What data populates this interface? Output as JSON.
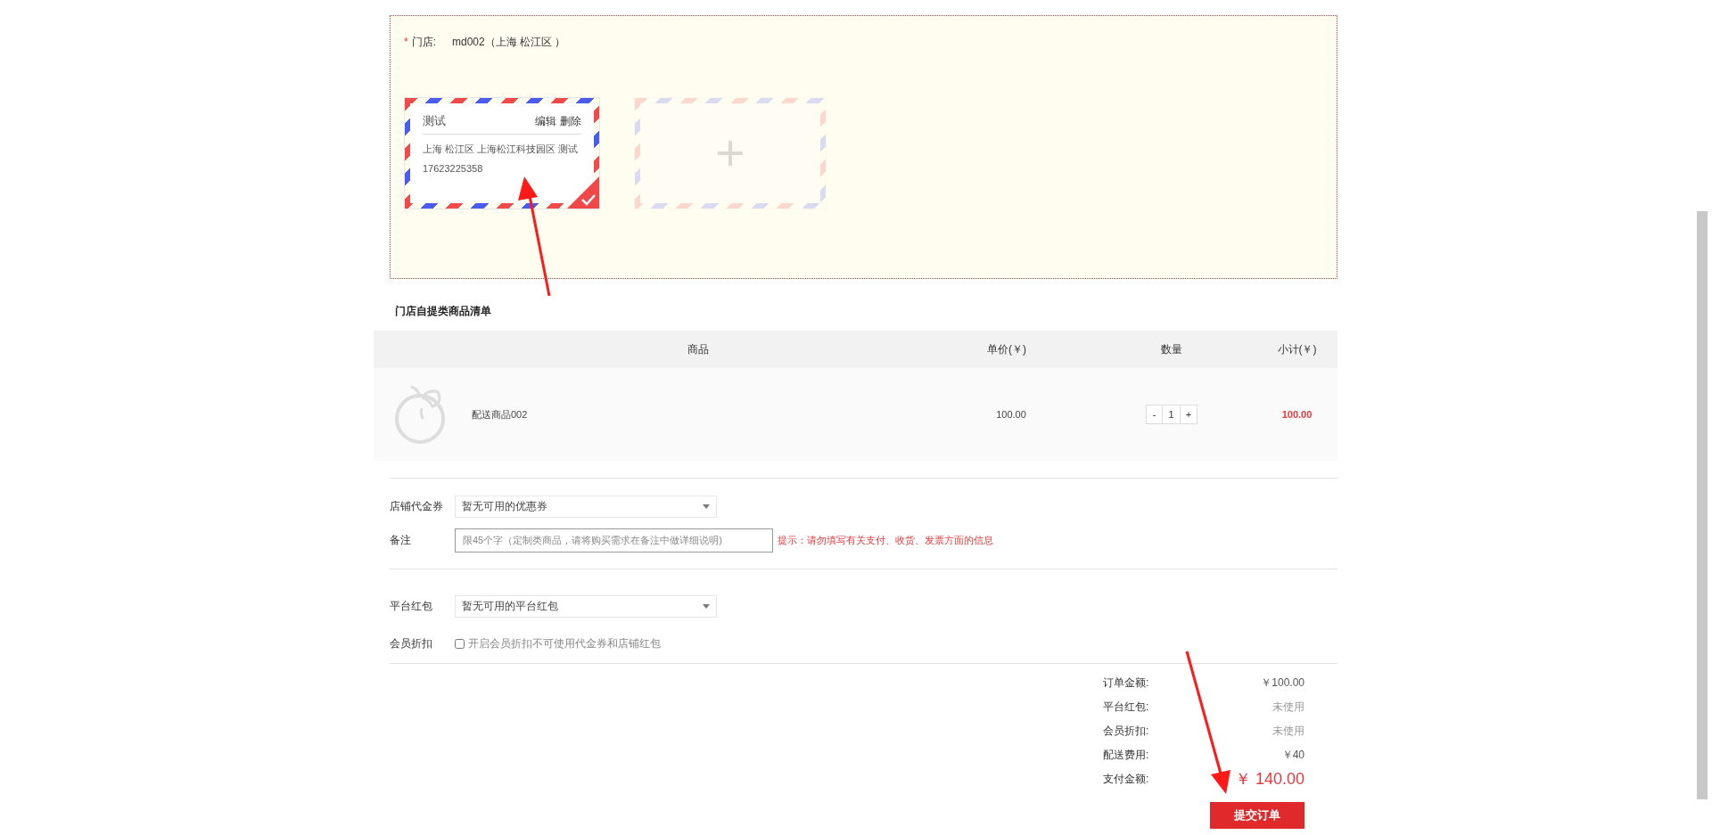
{
  "store": {
    "required_mark": "*",
    "label": "门店:",
    "value": "md002（上海 松江区 ）"
  },
  "addresses": [
    {
      "name": "测试",
      "actions": [
        "编辑",
        "删除"
      ],
      "address": "上海 松江区 上海松江科技园区 测试",
      "phone": "17623225358",
      "selected": true
    }
  ],
  "section_title": "门店自提类商品清单",
  "table": {
    "columns": [
      "商品",
      "单价(￥)",
      "数量",
      "小计(￥)"
    ],
    "rows": [
      {
        "product": "配送商品002",
        "price": "100.00",
        "minus": "-",
        "quantity": "1",
        "plus": "+",
        "subtotal": "100.00"
      }
    ]
  },
  "coupon": {
    "label": "店铺代金券",
    "value": "暂无可用的优惠券"
  },
  "remark": {
    "label": "备注",
    "placeholder": "限45个字（定制类商品，请将购买需求在备注中做详细说明)",
    "hint": "提示：请勿填写有关支付、收货、发票方面的信息"
  },
  "red_packet": {
    "label": "平台红包",
    "value": "暂无可用的平台红包"
  },
  "member_discount": {
    "label": "会员折扣",
    "text": "开启会员折扣不可使用代金券和店铺红包",
    "checked": false
  },
  "summary": [
    {
      "label": "订单金额:",
      "value": "￥100.00",
      "kind": "normal"
    },
    {
      "label": "平台红包:",
      "value": "未使用",
      "kind": "muted"
    },
    {
      "label": "会员折扣:",
      "value": "未使用",
      "kind": "muted"
    },
    {
      "label": "配送费用:",
      "value": "￥40",
      "kind": "normal"
    },
    {
      "label": "支付金额:",
      "value": "￥ 140.00",
      "kind": "total"
    }
  ],
  "submit": "提交订单"
}
